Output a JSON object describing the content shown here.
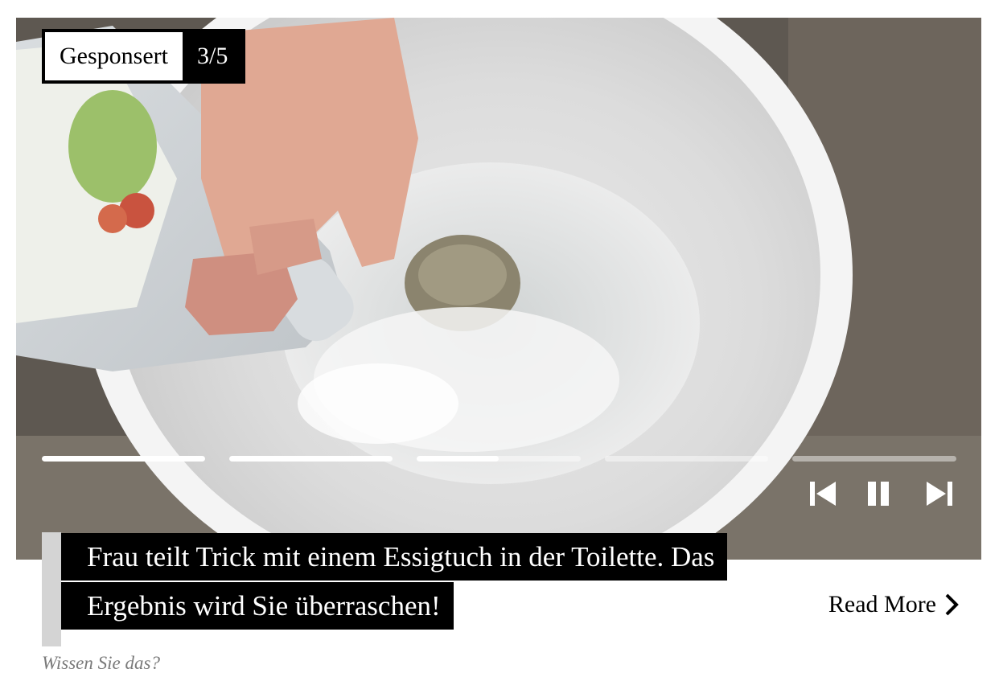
{
  "badge": {
    "sponsored_label": "Gesponsert",
    "counter": "3/5"
  },
  "slides": {
    "current": 3,
    "total": 5,
    "progress": [
      1.0,
      1.0,
      0.5,
      0.0,
      0.0
    ]
  },
  "controls": {
    "prev_icon": "skip-previous-icon",
    "pause_icon": "pause-icon",
    "next_icon": "skip-next-icon"
  },
  "caption": {
    "title": "Frau teilt Trick mit einem Essigtuch in der Toilette. Das Ergebnis wird Sie überraschen!"
  },
  "read_more": {
    "label": "Read More",
    "icon": "chevron-right-icon"
  },
  "source": {
    "label": "Wissen Sie das?"
  },
  "colors": {
    "caption_bg": "#000000",
    "caption_text": "#ffffff",
    "accent_bar": "#d4d4d4",
    "source_text": "#7a7a7a"
  }
}
